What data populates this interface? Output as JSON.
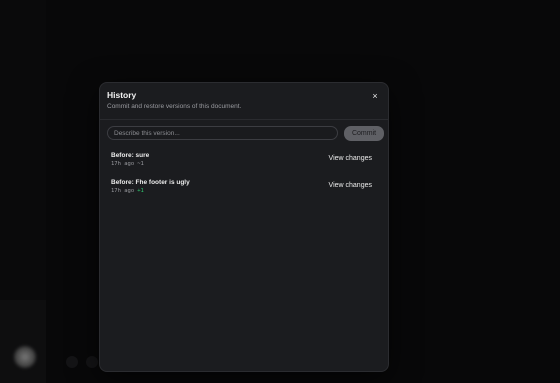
{
  "history_dialog": {
    "title": "History",
    "subtitle": "Commit and restore versions of this document.",
    "close_glyph": "×",
    "commit_input": {
      "placeholder": "Describe this version...",
      "value": ""
    },
    "commit_button_label": "Commit",
    "versions": [
      {
        "title": "Before: sure",
        "time": "17h ago",
        "delta": "~1",
        "delta_kind": "neutral",
        "action_label": "View changes"
      },
      {
        "title": "Before: Fhe footer is ugly",
        "time": "17h ago",
        "delta": "+1",
        "delta_kind": "positive",
        "action_label": "View changes"
      }
    ]
  },
  "colors": {
    "background": "#0d0d0e",
    "dialog_background": "#1b1c1f",
    "dialog_border": "#2b2c30",
    "commit_button": "#5f6065",
    "delta_positive": "#2fc66f",
    "muted_text": "#9a9ba0"
  },
  "icons": {
    "close": "close-icon",
    "user_avatar": "avatar"
  }
}
